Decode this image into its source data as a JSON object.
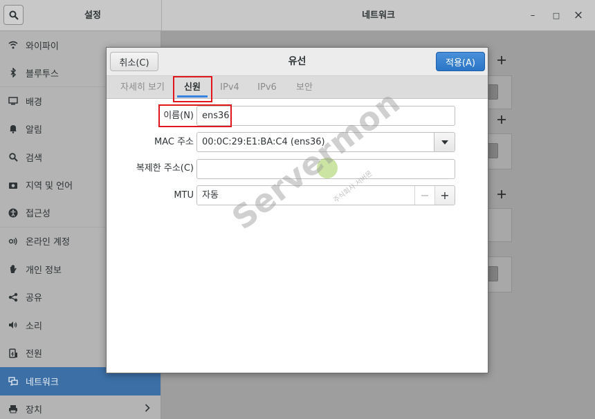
{
  "header": {
    "left_title": "설정",
    "right_title": "네트워크",
    "minimize": "–",
    "maximize": "□",
    "close": "×"
  },
  "sidebar": {
    "items": [
      {
        "label": "와이파이",
        "icon": "wifi-icon"
      },
      {
        "label": "블루투스",
        "icon": "bluetooth-icon"
      },
      {
        "label": "배경",
        "icon": "background-icon"
      },
      {
        "label": "알림",
        "icon": "bell-icon"
      },
      {
        "label": "검색",
        "icon": "search-icon"
      },
      {
        "label": "지역 및 언어",
        "icon": "camera-icon"
      },
      {
        "label": "접근성",
        "icon": "accessibility-icon"
      },
      {
        "label": "온라인 계정",
        "icon": "online-accounts-icon"
      },
      {
        "label": "개인 정보",
        "icon": "hand-icon"
      },
      {
        "label": "공유",
        "icon": "share-icon"
      },
      {
        "label": "소리",
        "icon": "speaker-icon"
      },
      {
        "label": "전원",
        "icon": "power-icon"
      },
      {
        "label": "네트워크",
        "icon": "network-icon"
      },
      {
        "label": "장치",
        "icon": "printer-icon"
      }
    ],
    "active_index": 12
  },
  "dialog": {
    "title": "유선",
    "cancel_label": "취소(C)",
    "apply_label": "적용(A)",
    "tabs": [
      {
        "label": "자세히 보기"
      },
      {
        "label": "신원"
      },
      {
        "label": "IPv4"
      },
      {
        "label": "IPv6"
      },
      {
        "label": "보안"
      }
    ],
    "active_tab": 1,
    "fields": {
      "name_label": "이름(N)",
      "name_value": "ens36",
      "mac_label": "MAC 주소",
      "mac_value": "00:0C:29:E1:BA:C4 (ens36)",
      "cloned_label": "복제한 주소(C)",
      "cloned_value": "",
      "mtu_label": "MTU",
      "mtu_value": "자동",
      "mtu_minus": "−",
      "mtu_plus": "+"
    }
  },
  "watermark": {
    "text": "Servermon",
    "sub": "주식회사 서버몬"
  },
  "colors": {
    "accent": "#3584e4",
    "apply_button": "#2a76c6",
    "highlight": "#e0161b",
    "sidebar_active": "#3b6fa6"
  }
}
